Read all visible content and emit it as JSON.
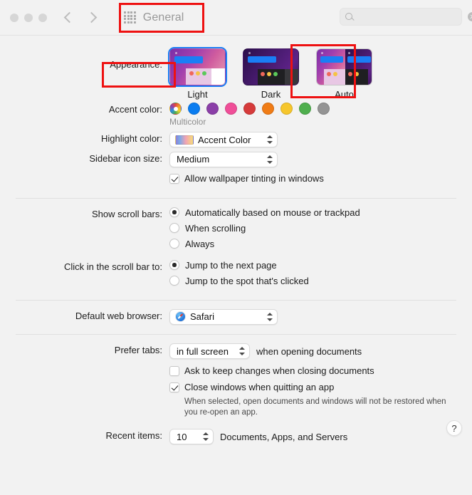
{
  "window": {
    "title": "General",
    "title_icon": "grid-icon",
    "traffic_lights": [
      "close",
      "minimize",
      "zoom"
    ],
    "nav": {
      "back_icon": "chevron-left-icon",
      "forward_icon": "chevron-right-icon"
    }
  },
  "search": {
    "placeholder": "",
    "value": "",
    "icon": "search-icon",
    "clear_icon": "clear-icon"
  },
  "appearance": {
    "label": "Appearance:",
    "options": [
      {
        "name": "Light",
        "selected": true
      },
      {
        "name": "Dark",
        "selected": false
      },
      {
        "name": "Auto",
        "selected": false
      }
    ]
  },
  "accent_color": {
    "label": "Accent color:",
    "caption": "Multicolor",
    "swatches": [
      {
        "name": "Multicolor",
        "color": "multicolor",
        "selected": true
      },
      {
        "name": "Blue",
        "color": "#0a7cf0"
      },
      {
        "name": "Purple",
        "color": "#8b3fa8"
      },
      {
        "name": "Pink",
        "color": "#f04e98"
      },
      {
        "name": "Red",
        "color": "#d63b3b"
      },
      {
        "name": "Orange",
        "color": "#f07c16"
      },
      {
        "name": "Yellow",
        "color": "#f6c62c"
      },
      {
        "name": "Green",
        "color": "#4faf4e"
      },
      {
        "name": "Graphite",
        "color": "#949494"
      }
    ]
  },
  "highlight_color": {
    "label": "Highlight color:",
    "value": "Accent Color",
    "swatch_icon": "gradient-swatch-icon"
  },
  "sidebar_icon_size": {
    "label": "Sidebar icon size:",
    "value": "Medium"
  },
  "wallpaper_tinting": {
    "label": "Allow wallpaper tinting in windows",
    "checked": true
  },
  "scroll_bars": {
    "label": "Show scroll bars:",
    "options": [
      {
        "label": "Automatically based on mouse or trackpad",
        "selected": true
      },
      {
        "label": "When scrolling",
        "selected": false
      },
      {
        "label": "Always",
        "selected": false
      }
    ]
  },
  "scroll_bar_click": {
    "label": "Click in the scroll bar to:",
    "options": [
      {
        "label": "Jump to the next page",
        "selected": true
      },
      {
        "label": "Jump to the spot that's clicked",
        "selected": false
      }
    ]
  },
  "default_browser": {
    "label": "Default web browser:",
    "value": "Safari",
    "icon": "safari-icon"
  },
  "prefer_tabs": {
    "label": "Prefer tabs:",
    "value": "in full screen",
    "suffix": "when opening documents"
  },
  "ask_keep_changes": {
    "label": "Ask to keep changes when closing documents",
    "checked": false
  },
  "close_windows": {
    "label": "Close windows when quitting an app",
    "checked": true,
    "hint": "When selected, open documents and windows will not be restored when you re-open an app."
  },
  "recent_items": {
    "label": "Recent items:",
    "value": "10",
    "suffix": "Documents, Apps, and Servers"
  },
  "help_button": {
    "label": "?"
  },
  "annotations": {
    "color": "#ee1111",
    "boxes": [
      "title-general",
      "appearance-label",
      "auto-theme"
    ]
  }
}
